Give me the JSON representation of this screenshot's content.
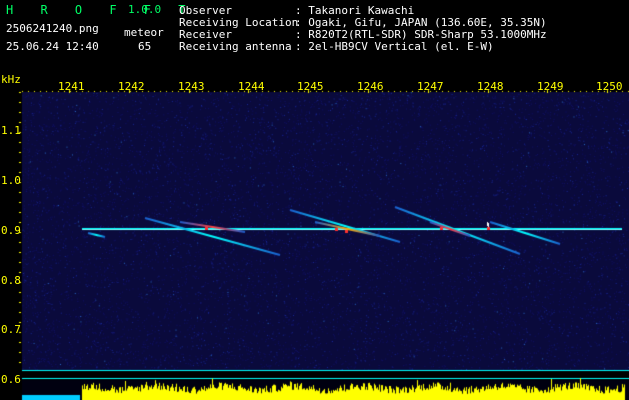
{
  "app": {
    "logo": "H R O F F T",
    "version": "1.0.0"
  },
  "file": {
    "name": "2506241240.png",
    "datetime": "25.06.24 12:40"
  },
  "meteor": {
    "label": "meteor",
    "count": "65"
  },
  "info": {
    "labels": [
      "Observer",
      "Receiving Location",
      "Receiver",
      "Receiving antenna"
    ],
    "values": [
      ": Takanori Kawachi",
      ": Ogaki, Gifu, JAPAN (136.60E, 35.35N)",
      ": R820T2(RTL-SDR) SDR-Sharp 53.1000MHz",
      ": 2el-HB9CV Vertical (el. E-W)"
    ]
  },
  "plot": {
    "unit_label": "kHz",
    "x_ticks": [
      "1241",
      "1242",
      "1243",
      "1244",
      "1245",
      "1246",
      "1247",
      "1248",
      "1249",
      "1250"
    ],
    "y_ticks": [
      "1.1",
      "1.0",
      "0.9",
      "0.8",
      "0.7",
      "0.6"
    ],
    "colors": {
      "background": "#0a0a3c",
      "signal": "#00ffff",
      "activity": "#ffff00",
      "baseline": "#00ffff"
    }
  }
}
